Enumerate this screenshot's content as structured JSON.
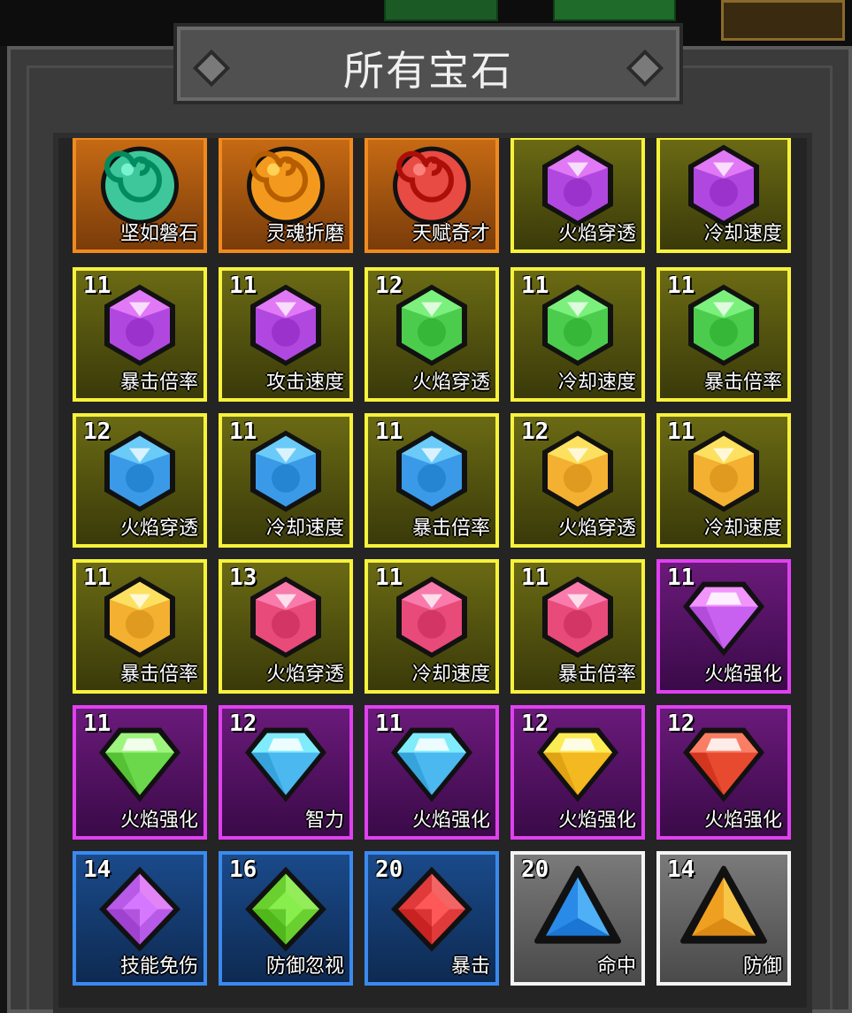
{
  "title": "所有宝石",
  "rows": [
    [
      {
        "level": "",
        "name": "坚如磐石",
        "frame": "orange",
        "shape": "orb",
        "color": "#3ec79a"
      },
      {
        "level": "",
        "name": "灵魂折磨",
        "frame": "orange",
        "shape": "orb",
        "color": "#f39a1e"
      },
      {
        "level": "",
        "name": "天赋奇才",
        "frame": "orange",
        "shape": "orb",
        "color": "#e84a44"
      },
      {
        "level": "",
        "name": "火焰穿透",
        "frame": "yellow",
        "shape": "hex",
        "color": "#b048e0"
      },
      {
        "level": "",
        "name": "冷却速度",
        "frame": "yellow",
        "shape": "hex",
        "color": "#b048e0"
      }
    ],
    [
      {
        "level": "11",
        "name": "暴击倍率",
        "frame": "yellow",
        "shape": "hex",
        "color": "#b048e0"
      },
      {
        "level": "11",
        "name": "攻击速度",
        "frame": "yellow",
        "shape": "hex",
        "color": "#b048e0"
      },
      {
        "level": "12",
        "name": "火焰穿透",
        "frame": "yellow",
        "shape": "hex",
        "color": "#4ccc4c"
      },
      {
        "level": "11",
        "name": "冷却速度",
        "frame": "yellow",
        "shape": "hex",
        "color": "#4ccc4c"
      },
      {
        "level": "11",
        "name": "暴击倍率",
        "frame": "yellow",
        "shape": "hex",
        "color": "#4ccc4c"
      }
    ],
    [
      {
        "level": "12",
        "name": "火焰穿透",
        "frame": "yellow",
        "shape": "hex",
        "color": "#3a9ae8"
      },
      {
        "level": "11",
        "name": "冷却速度",
        "frame": "yellow",
        "shape": "hex",
        "color": "#3a9ae8"
      },
      {
        "level": "11",
        "name": "暴击倍率",
        "frame": "yellow",
        "shape": "hex",
        "color": "#3a9ae8"
      },
      {
        "level": "12",
        "name": "火焰穿透",
        "frame": "yellow",
        "shape": "hex",
        "color": "#f4b030"
      },
      {
        "level": "11",
        "name": "冷却速度",
        "frame": "yellow",
        "shape": "hex",
        "color": "#f4b030"
      }
    ],
    [
      {
        "level": "11",
        "name": "暴击倍率",
        "frame": "yellow",
        "shape": "hex",
        "color": "#f4b030"
      },
      {
        "level": "13",
        "name": "火焰穿透",
        "frame": "yellow",
        "shape": "hex",
        "color": "#e84a7a"
      },
      {
        "level": "11",
        "name": "冷却速度",
        "frame": "yellow",
        "shape": "hex",
        "color": "#e84a7a"
      },
      {
        "level": "11",
        "name": "暴击倍率",
        "frame": "yellow",
        "shape": "hex",
        "color": "#e84a7a"
      },
      {
        "level": "11",
        "name": "火焰强化",
        "frame": "purple",
        "shape": "diamond",
        "color": "#c860f0"
      }
    ],
    [
      {
        "level": "11",
        "name": "火焰强化",
        "frame": "purple",
        "shape": "diamond",
        "color": "#6ad84a"
      },
      {
        "level": "12",
        "name": "智力",
        "frame": "purple",
        "shape": "diamond",
        "color": "#4cb8f0"
      },
      {
        "level": "11",
        "name": "火焰强化",
        "frame": "purple",
        "shape": "diamond",
        "color": "#4cb8f0"
      },
      {
        "level": "12",
        "name": "火焰强化",
        "frame": "purple",
        "shape": "diamond",
        "color": "#f4b820"
      },
      {
        "level": "12",
        "name": "火焰强化",
        "frame": "purple",
        "shape": "diamond",
        "color": "#e84a30"
      }
    ],
    [
      {
        "level": "14",
        "name": "技能免伤",
        "frame": "blue",
        "shape": "rhomb",
        "color": "#b85ae8"
      },
      {
        "level": "16",
        "name": "防御忽视",
        "frame": "blue",
        "shape": "rhomb",
        "color": "#6ad030"
      },
      {
        "level": "20",
        "name": "暴击",
        "frame": "blue",
        "shape": "rhomb",
        "color": "#e03a3a"
      },
      {
        "level": "20",
        "name": "命中",
        "frame": "gray",
        "shape": "tri",
        "color": "#2a8ae8"
      },
      {
        "level": "14",
        "name": "防御",
        "frame": "gray",
        "shape": "tri",
        "color": "#f0a020"
      }
    ]
  ]
}
